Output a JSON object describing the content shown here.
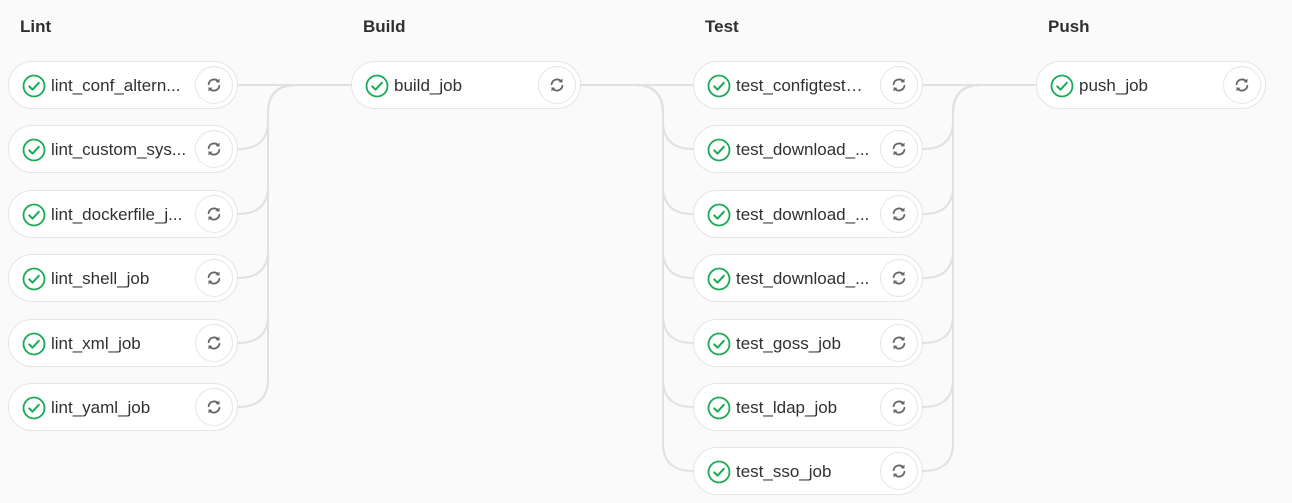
{
  "pipeline": {
    "colors": {
      "success": "#1aaa55",
      "connector": "#e1e1e1",
      "border": "#e5e5e5"
    },
    "stages": [
      {
        "title": "Lint",
        "jobs": [
          {
            "name": "lint_conf_altern...",
            "status": "success",
            "action_icon": "retry-icon"
          },
          {
            "name": "lint_custom_sys...",
            "status": "success",
            "action_icon": "retry-icon"
          },
          {
            "name": "lint_dockerfile_j...",
            "status": "success",
            "action_icon": "retry-icon"
          },
          {
            "name": "lint_shell_job",
            "status": "success",
            "action_icon": "retry-icon"
          },
          {
            "name": "lint_xml_job",
            "status": "success",
            "action_icon": "retry-icon"
          },
          {
            "name": "lint_yaml_job",
            "status": "success",
            "action_icon": "retry-icon"
          }
        ]
      },
      {
        "title": "Build",
        "jobs": [
          {
            "name": "build_job",
            "status": "success",
            "action_icon": "retry-icon"
          }
        ]
      },
      {
        "title": "Test",
        "jobs": [
          {
            "name": "test_configtest_j...",
            "status": "success",
            "action_icon": "retry-icon"
          },
          {
            "name": "test_download_...",
            "status": "success",
            "action_icon": "retry-icon"
          },
          {
            "name": "test_download_...",
            "status": "success",
            "action_icon": "retry-icon"
          },
          {
            "name": "test_download_...",
            "status": "success",
            "action_icon": "retry-icon"
          },
          {
            "name": "test_goss_job",
            "status": "success",
            "action_icon": "retry-icon"
          },
          {
            "name": "test_ldap_job",
            "status": "success",
            "action_icon": "retry-icon"
          },
          {
            "name": "test_sso_job",
            "status": "success",
            "action_icon": "retry-icon"
          }
        ]
      },
      {
        "title": "Push",
        "jobs": [
          {
            "name": "push_job",
            "status": "success",
            "action_icon": "retry-icon"
          }
        ]
      }
    ]
  }
}
